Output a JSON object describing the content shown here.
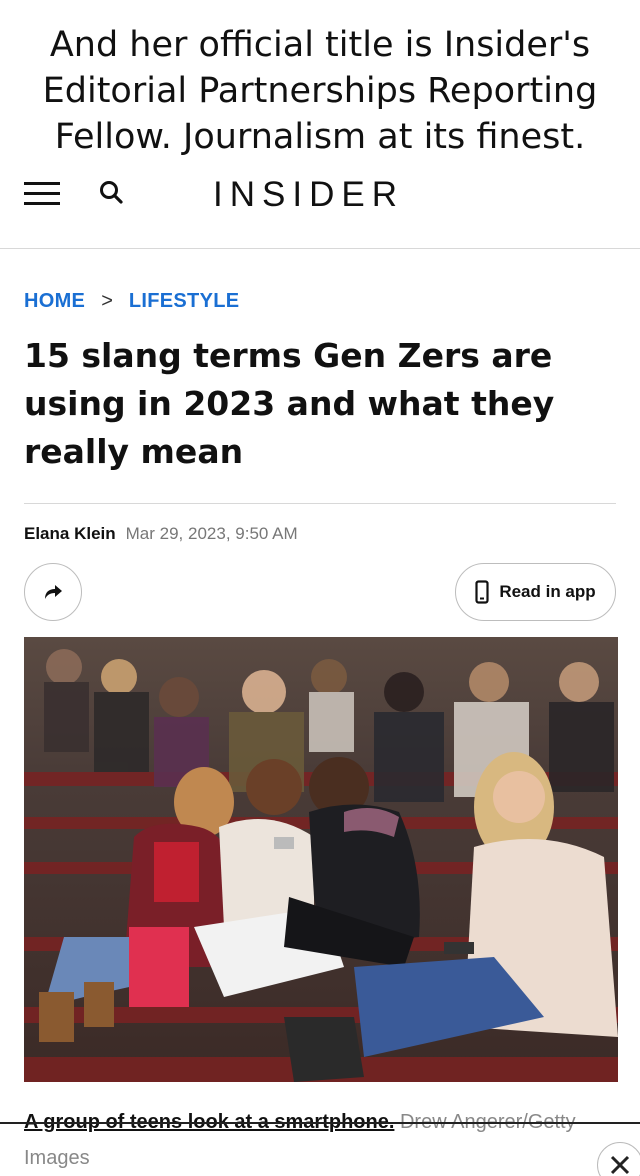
{
  "meme_caption": {
    "lines": [
      "And her official title is Insider's",
      "Editorial Partnerships Reporting",
      "Fellow. Journalism at its finest."
    ]
  },
  "header": {
    "logo": "INSIDER",
    "menu_icon": "hamburger-menu-icon",
    "search_icon": "search-icon"
  },
  "breadcrumb": {
    "home": "HOME",
    "separator": ">",
    "section": "LIFESTYLE"
  },
  "article": {
    "headline": "15 slang terms Gen Zers are using in 2023 and what they really mean",
    "author": "Elana Klein",
    "date": "Mar 29, 2023, 9:50 AM",
    "share_icon": "share-arrow-icon",
    "read_in_app_label": "Read in app",
    "read_in_app_icon": "phone-icon"
  },
  "image": {
    "caption": "A group of teens look at a smartphone.",
    "credit": "Drew Angerer/Getty Images"
  },
  "overlay": {
    "close_icon": "close-icon"
  },
  "colors": {
    "link_blue": "#1a6fd3",
    "text": "#111111",
    "muted": "#777777",
    "divider": "#d8d8d8"
  }
}
